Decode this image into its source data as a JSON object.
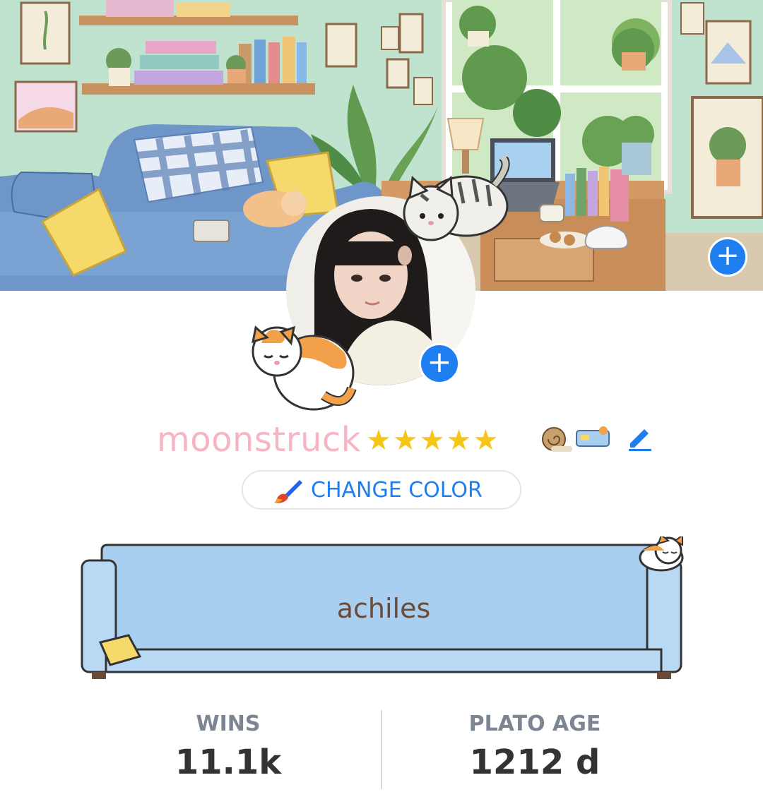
{
  "profile": {
    "username": "moonstruck",
    "stars": "★★★★★",
    "nickname": "achiles",
    "change_color_label": "CHANGE COLOR"
  },
  "stats": [
    {
      "label": "WINS",
      "value": "11.1k"
    },
    {
      "label": "PLATO AGE",
      "value": "1212 d"
    }
  ],
  "icons": {
    "add_banner": "plus-icon",
    "add_avatar": "plus-icon",
    "edit": "pencil-icon",
    "brush": "paintbrush-icon"
  },
  "colors": {
    "accent": "#1f7ff0",
    "username": "#f7b5c3",
    "sofa": "#a9cff0"
  }
}
